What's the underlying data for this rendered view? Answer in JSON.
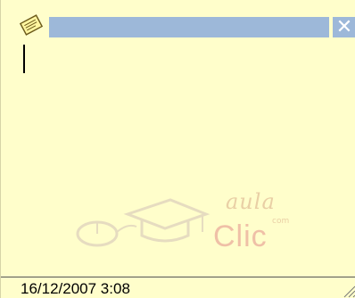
{
  "note": {
    "title": "",
    "close_label": "✕",
    "body_text": "",
    "timestamp": "16/12/2007 3:08"
  },
  "watermark": {
    "brand_top": "aula",
    "brand_suffix": "com",
    "brand_main": "Clic"
  },
  "colors": {
    "note_background": "#fffecb",
    "titlebar": "#9db8d9",
    "watermark": "#efc0a7"
  }
}
